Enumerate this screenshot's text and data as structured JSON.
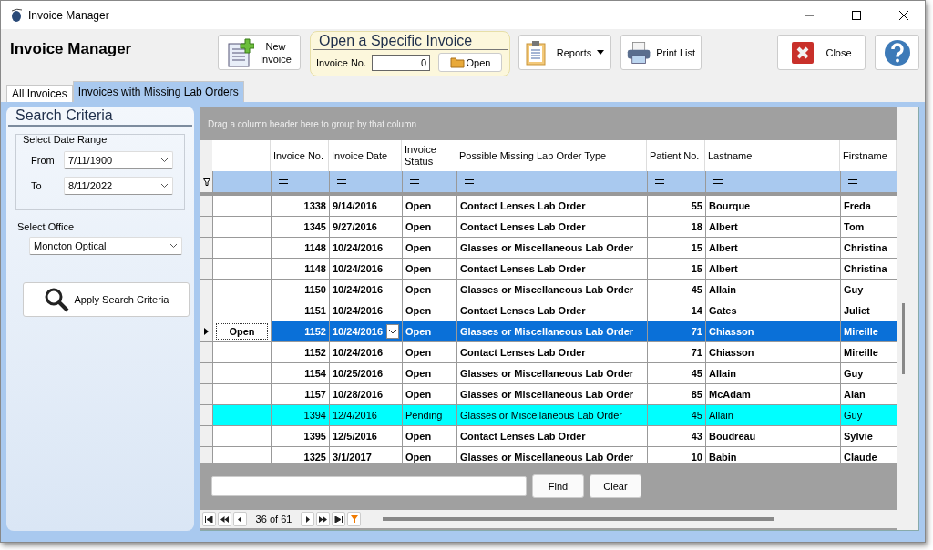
{
  "window": {
    "title": "Invoice Manager"
  },
  "header": {
    "title": "Invoice Manager",
    "new_button": [
      "New",
      "Invoice"
    ],
    "open_group": {
      "title": "Open a Specific Invoice",
      "label": "Invoice No.",
      "value": "0",
      "button": "Open"
    },
    "reports_button": "Reports",
    "print_button": "Print List",
    "close_button": "Close"
  },
  "tabs": [
    {
      "label": "All Invoices",
      "selected": false
    },
    {
      "label": "Invoices with Missing Lab Orders",
      "selected": true
    }
  ],
  "search": {
    "title": "Search Criteria",
    "date_group": "Select Date Range",
    "from_label": "From",
    "from_value": "7/11/1900",
    "to_label": "To",
    "to_value": "8/11/2022",
    "office_label": "Select Office",
    "office_value": "Moncton Optical",
    "apply_button": "Apply Search Criteria"
  },
  "grid": {
    "group_hint": "Drag a column header here to group by that column",
    "columns": [
      "Invoice No.",
      "Invoice Date",
      "Invoice Status",
      "Possible Missing Lab Order Type",
      "Patient No.",
      "Lastname",
      "Firstname"
    ],
    "rows": [
      {
        "kind": "normal",
        "selected": false,
        "cells": [
          "1338",
          "9/14/2016",
          "Open",
          "Contact Lenses Lab Order",
          "55",
          "Bourque",
          "Freda"
        ]
      },
      {
        "kind": "normal",
        "selected": false,
        "cells": [
          "1345",
          "9/27/2016",
          "Open",
          "Contact Lenses Lab Order",
          "18",
          "Albert",
          "Tom"
        ]
      },
      {
        "kind": "normal",
        "selected": false,
        "cells": [
          "1148",
          "10/24/2016",
          "Open",
          "Glasses or Miscellaneous Lab Order",
          "15",
          "Albert",
          "Christina"
        ]
      },
      {
        "kind": "normal",
        "selected": false,
        "cells": [
          "1148",
          "10/24/2016",
          "Open",
          "Contact Lenses Lab Order",
          "15",
          "Albert",
          "Christina"
        ]
      },
      {
        "kind": "normal",
        "selected": false,
        "cells": [
          "1150",
          "10/24/2016",
          "Open",
          "Glasses or Miscellaneous Lab Order",
          "45",
          "Allain",
          "Guy"
        ]
      },
      {
        "kind": "normal",
        "selected": false,
        "cells": [
          "1151",
          "10/24/2016",
          "Open",
          "Contact Lenses Lab Order",
          "14",
          "Gates",
          "Juliet"
        ]
      },
      {
        "kind": "normal",
        "selected": true,
        "open_button": "Open",
        "cells": [
          "1152",
          "10/24/2016",
          "Open",
          "Glasses or Miscellaneous Lab Order",
          "71",
          "Chiasson",
          "Mireille"
        ]
      },
      {
        "kind": "normal",
        "selected": false,
        "cells": [
          "1152",
          "10/24/2016",
          "Open",
          "Contact Lenses Lab Order",
          "71",
          "Chiasson",
          "Mireille"
        ]
      },
      {
        "kind": "normal",
        "selected": false,
        "cells": [
          "1154",
          "10/25/2016",
          "Open",
          "Glasses or Miscellaneous Lab Order",
          "45",
          "Allain",
          "Guy"
        ]
      },
      {
        "kind": "normal",
        "selected": false,
        "cells": [
          "1157",
          "10/28/2016",
          "Open",
          "Glasses or Miscellaneous Lab Order",
          "85",
          "McAdam",
          "Alan"
        ]
      },
      {
        "kind": "pending",
        "selected": false,
        "cells": [
          "1394",
          "12/4/2016",
          "Pending",
          "Glasses or Miscellaneous Lab Order",
          "45",
          "Allain",
          "Guy"
        ]
      },
      {
        "kind": "normal",
        "selected": false,
        "cells": [
          "1395",
          "12/5/2016",
          "Open",
          "Contact Lenses Lab Order",
          "43",
          "Boudreau",
          "Sylvie"
        ]
      },
      {
        "kind": "normal",
        "selected": false,
        "cells": [
          "1325",
          "3/1/2017",
          "Open",
          "Glasses or Miscellaneous Lab Order",
          "10",
          "Babin",
          "Claude"
        ]
      }
    ],
    "find_button": "Find",
    "clear_button": "Clear",
    "position": "36 of 61"
  }
}
